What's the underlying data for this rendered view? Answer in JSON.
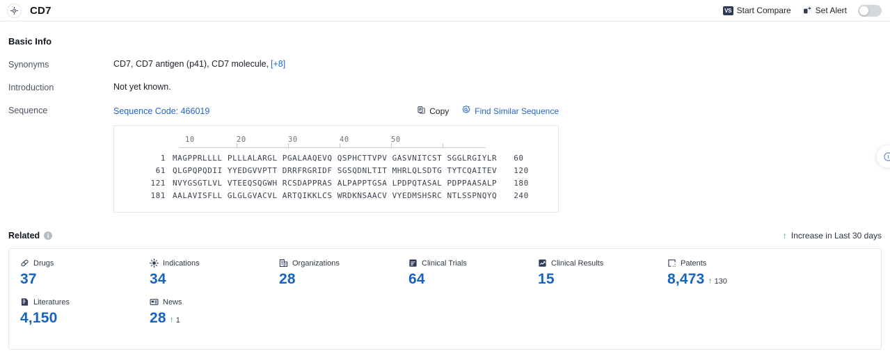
{
  "header": {
    "title": "CD7",
    "target_icon": "target-icon",
    "actions": [
      {
        "label": "Start Compare",
        "icon": "vs-icon",
        "icon_text": "VS"
      },
      {
        "label": "Set Alert",
        "icon": "alert-bell-icon"
      }
    ],
    "toggle_state": "off"
  },
  "basic_info": {
    "section_title": "Basic Info",
    "rows": [
      {
        "label": "Synonyms",
        "value": "CD7,  CD7 antigen (p41),  CD7 molecule,",
        "more": "[+8]"
      },
      {
        "label": "Introduction",
        "value": "Not yet known."
      },
      {
        "label": "Sequence",
        "value": ""
      }
    ]
  },
  "sequence": {
    "code_label": "Sequence Code: 466019",
    "tools": [
      {
        "label": "Copy",
        "icon": "copy-icon"
      },
      {
        "label": "Find Similar Sequence",
        "icon": "find-similar-icon"
      }
    ],
    "ruler": [
      "10",
      "20",
      "30",
      "40",
      "50"
    ],
    "rows": [
      {
        "start": "1",
        "letters": "MAGPPRLLLL PLLLALARGL PGALAAQEVQ QSPHCTTVPV GASVNITCST SGGLRGIYLR",
        "end": "60"
      },
      {
        "start": "61",
        "letters": "QLGPQPQDII YYEDGVVPTT DRRFRGRIDF SGSQDNLTIT MHRLQLSDTG TYTCQAITEV",
        "end": "120"
      },
      {
        "start": "121",
        "letters": "NVYGSGTLVL VTEEQSQGWH RCSDAPPRAS ALPAPPTGSA LPDPQTASAL PDPPAASALP",
        "end": "180"
      },
      {
        "start": "181",
        "letters": "AALAVISFLL GLGLGVACVL ARTQIKKLCS WRDKNSAACV VYEDMSHSRC NTLSSPNQYQ",
        "end": "240"
      }
    ]
  },
  "related": {
    "title": "Related",
    "info_char": "i",
    "legend": "Increase in Last 30 days",
    "legend_arrow": "↑",
    "stats": [
      {
        "label": "Drugs",
        "icon": "capsule-icon",
        "value": "37"
      },
      {
        "label": "Indications",
        "icon": "virus-icon",
        "value": "34"
      },
      {
        "label": "Organizations",
        "icon": "building-icon",
        "value": "28"
      },
      {
        "label": "Clinical Trials",
        "icon": "clinical-trial-icon",
        "value": "64"
      },
      {
        "label": "Clinical Results",
        "icon": "chart-icon",
        "value": "15"
      },
      {
        "label": "Patents",
        "icon": "patent-icon",
        "value": "8,473",
        "delta": "130",
        "delta_arrow": "↑"
      },
      {
        "label": "Literatures",
        "icon": "book-icon",
        "value": "4,150"
      },
      {
        "label": "News",
        "icon": "news-icon",
        "value": "28",
        "delta": "1",
        "delta_arrow": "↑"
      }
    ]
  },
  "colors": {
    "accent_blue": "#1664c0",
    "link_blue": "#2166c9",
    "increase_green": "#2f9e44",
    "icon_dark": "#2c3a57"
  }
}
